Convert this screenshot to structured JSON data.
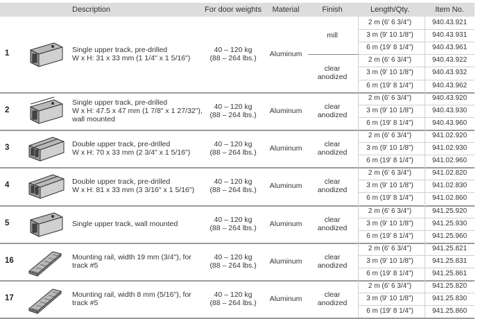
{
  "headers": {
    "description": "Description",
    "weights": "For door weights",
    "material": "Material",
    "finish": "Finish",
    "length": "Length/Qty.",
    "item": "Item No."
  },
  "rows": [
    {
      "num": "1",
      "icon": "single-track-icon",
      "desc_lines": [
        "Single upper track, pre-drilled",
        "W x H: 31 x 33 mm (1 1/4\" x 1 5/16\")"
      ],
      "weight_lines": [
        "40 – 120 kg",
        "(88 – 264 lbs.)"
      ],
      "material": "Aluminum",
      "finish_groups": [
        {
          "lines": [
            "mill"
          ]
        },
        {
          "lines": [
            "clear",
            "anodized"
          ]
        }
      ],
      "lengths": [
        "2 m (6' 6 3/4\")",
        "3 m (9' 10 1/8\")",
        "6 m (19' 8 1/4\")",
        "2 m (6' 6 3/4\")",
        "3 m (9' 10 1/8\")",
        "6 m (19' 8 1/4\")"
      ],
      "items": [
        "940.43.921",
        "940.43.931",
        "940.43.961",
        "940.43.922",
        "940.43.932",
        "940.43.962"
      ]
    },
    {
      "num": "2",
      "icon": "wall-mounted-track-icon",
      "desc_lines": [
        "Single upper track, pre-drilled",
        "W x H: 47.5 x 47 mm (1 7/8\" x 1 27/32\"),",
        "wall mounted"
      ],
      "weight_lines": [
        "40 – 120 kg",
        "(88 – 264 lbs.)"
      ],
      "material": "Aluminum",
      "finish_groups": [
        {
          "lines": [
            "clear",
            "anodized"
          ]
        }
      ],
      "lengths": [
        "2 m (6' 6 3/4\")",
        "3 m (9' 10 1/8\")",
        "6 m (19' 8 1/4\")"
      ],
      "items": [
        "940.43.920",
        "940.43.930",
        "940.43.960"
      ]
    },
    {
      "num": "3",
      "icon": "double-track-icon",
      "desc_lines": [
        "Double upper track, pre-drilled",
        "W x H: 70 x 33 mm (2 3/4\" x 1 5/16\")"
      ],
      "weight_lines": [
        "40 – 120 kg",
        "(88 – 264 lbs.)"
      ],
      "material": "Aluminum",
      "finish_groups": [
        {
          "lines": [
            "clear",
            "anodized"
          ]
        }
      ],
      "lengths": [
        "2 m (6' 6 3/4\")",
        "3 m (9' 10 1/8\")",
        "6 m (19' 8 1/4\")"
      ],
      "items": [
        "941.02.920",
        "941.02.930",
        "941.02.960"
      ]
    },
    {
      "num": "4",
      "icon": "double-track-icon",
      "desc_lines": [
        "Double upper track, pre-drilled",
        "W x H: 81 x 33 mm (3 3/16\" x 1 5/16\")"
      ],
      "weight_lines": [
        "40 – 120 kg",
        "(88 – 264 lbs.)"
      ],
      "material": "Aluminum",
      "finish_groups": [
        {
          "lines": [
            "clear",
            "anodized"
          ]
        }
      ],
      "lengths": [
        "2 m (6' 6 3/4\")",
        "3 m (9' 10 1/8\")",
        "6 m (19' 8 1/4\")"
      ],
      "items": [
        "941.02.820",
        "941.02.830",
        "941.02.860"
      ]
    },
    {
      "num": "5",
      "icon": "wall-track-icon",
      "desc_lines": [
        "Single upper track, wall mounted"
      ],
      "weight_lines": [
        "40 – 120 kg",
        "(88 – 264 lbs.)"
      ],
      "material": "Aluminum",
      "finish_groups": [
        {
          "lines": [
            "clear",
            "anodized"
          ]
        }
      ],
      "lengths": [
        "2 m (6' 6 3/4\")",
        "3 m (9' 10 1/8\")",
        "6 m (19' 8 1/4\")"
      ],
      "items": [
        "941.25.920",
        "941.25.930",
        "941.25.960"
      ]
    },
    {
      "num": "16",
      "icon": "mounting-rail-icon",
      "desc_lines": [
        "Mounting rail, width 19 mm (3/4\"), for",
        "track #5"
      ],
      "weight_lines": [
        "40 – 120 kg",
        "(88 – 264 lbs.)"
      ],
      "material": "Aluminum",
      "finish_groups": [
        {
          "lines": [
            "clear",
            "anodized"
          ]
        }
      ],
      "lengths": [
        "2 m (6' 6 3/4\")",
        "3 m (9' 10 1/8\")",
        "6 m (19' 8 1/4\")"
      ],
      "items": [
        "941.25.821",
        "941.25.831",
        "941.25.861"
      ]
    },
    {
      "num": "17",
      "icon": "mounting-rail-icon",
      "desc_lines": [
        "Mounting rail, width 8 mm (5/16\"), for",
        "track #5"
      ],
      "weight_lines": [
        "40 – 120 kg",
        "(88 – 264 lbs.)"
      ],
      "material": "Aluminum",
      "finish_groups": [
        {
          "lines": [
            "clear",
            "anodized"
          ]
        }
      ],
      "lengths": [
        "2 m (6' 6 3/4\")",
        "3 m (9' 10 1/8\")",
        "6 m (19' 8 1/4\")"
      ],
      "items": [
        "941.25.820",
        "941.25.830",
        "941.25.860"
      ]
    }
  ]
}
